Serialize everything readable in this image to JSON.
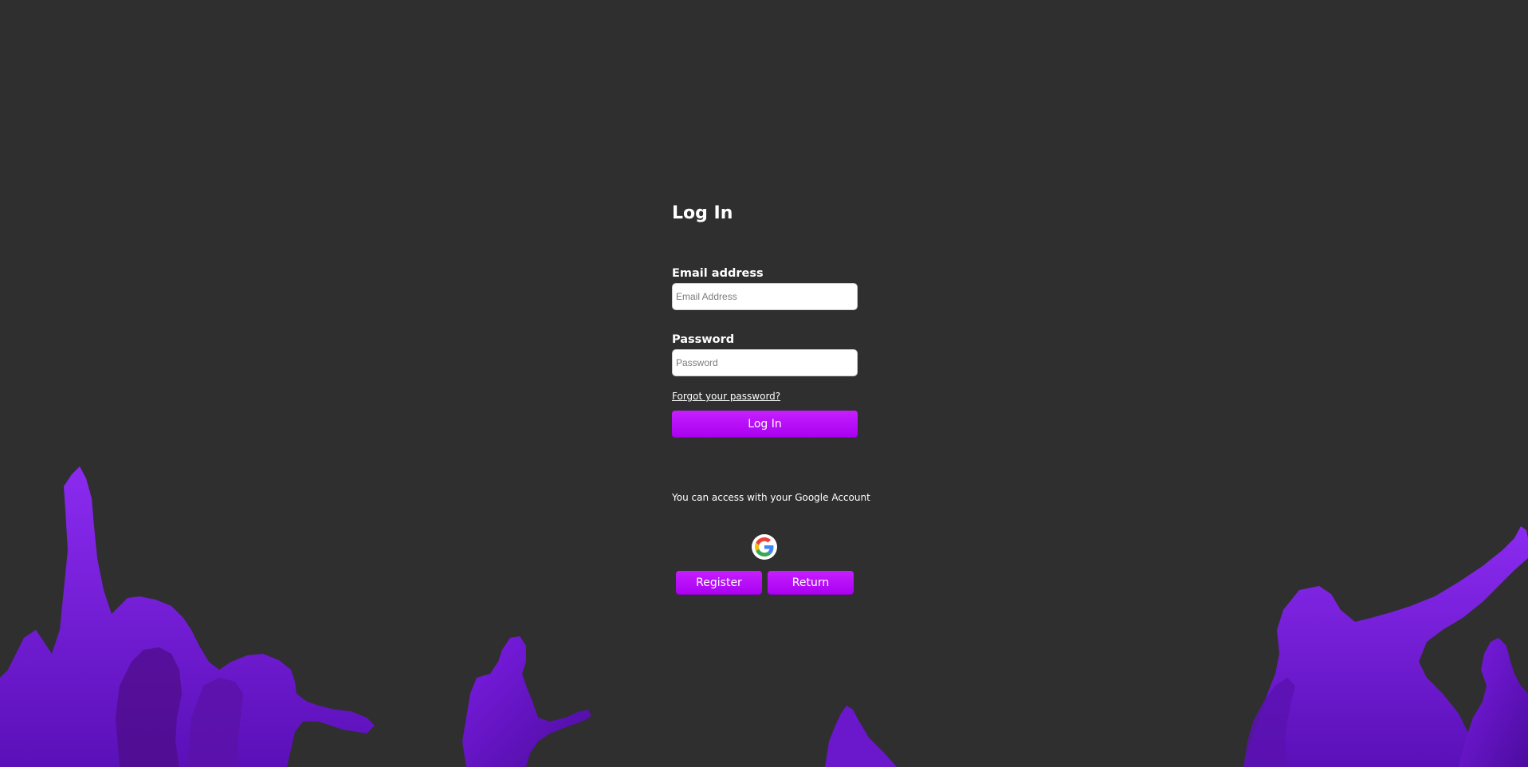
{
  "login": {
    "title": "Log In",
    "email_label": "Email address",
    "email_placeholder": "Email Address",
    "email_value": "",
    "password_label": "Password",
    "password_placeholder": "Password",
    "password_value": "",
    "forgot_link": "Forgot your password?",
    "submit_label": "Log In"
  },
  "google": {
    "prompt": "You can access with your Google Account",
    "icon": "google-logo-icon"
  },
  "actions": {
    "register_label": "Register",
    "return_label": "Return"
  },
  "colors": {
    "background": "#2f2f2f",
    "accent": "#b30bf7",
    "silhouette": "#7a1fe0"
  }
}
